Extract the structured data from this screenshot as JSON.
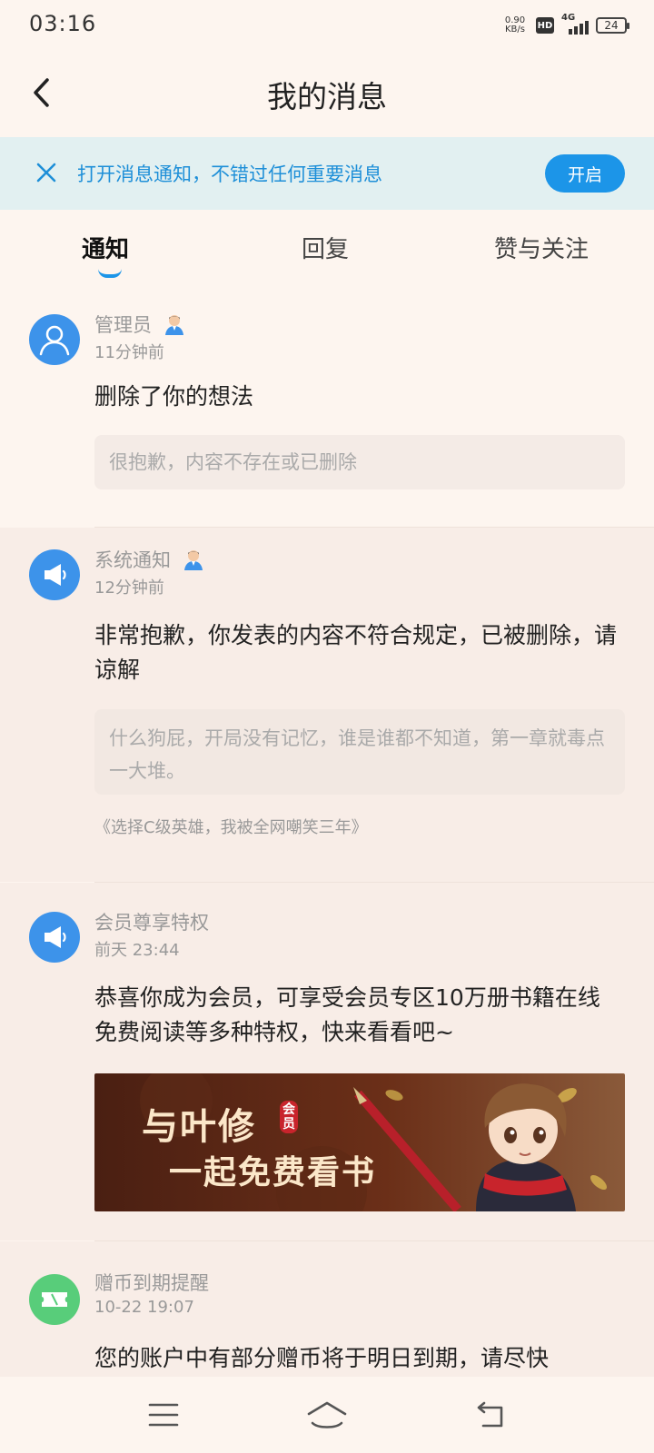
{
  "status_bar": {
    "time": "03:16",
    "net_speed_value": "0.90",
    "net_speed_unit": "KB/s",
    "hd": "HD",
    "network": "4G",
    "battery": "24"
  },
  "header": {
    "title": "我的消息"
  },
  "banner": {
    "text": "打开消息通知，不错过任何重要消息",
    "button": "开启"
  },
  "tabs": [
    {
      "label": "通知",
      "active": true
    },
    {
      "label": "回复",
      "active": false
    },
    {
      "label": "赞与关注",
      "active": false
    }
  ],
  "messages": [
    {
      "sender": "管理员",
      "time": "11分钟前",
      "content": "删除了你的想法",
      "quote": "很抱歉，内容不存在或已删除"
    },
    {
      "sender": "系统通知",
      "time": "12分钟前",
      "content": "非常抱歉，你发表的内容不符合规定，已被删除，请谅解",
      "quote": "什么狗屁，开局没有记忆，谁是谁都不知道，第一章就毒点一大堆。",
      "source": "《选择C级英雄，我被全网嘲笑三年》"
    },
    {
      "sender": "会员尊享特权",
      "time": "前天 23:44",
      "content": "恭喜你成为会员，可享受会员专区10万册书籍在线免费阅读等多种特权，快来看看吧~",
      "banner_line1": "与叶修",
      "banner_badge": "会员",
      "banner_line2": "一起免费看书"
    },
    {
      "sender": "赠币到期提醒",
      "time": "10-22 19:07",
      "content": "您的账户中有部分赠币将于明日到期，请尽快"
    }
  ],
  "colors": {
    "accent": "#1c95e8",
    "avatar_blue": "#3d93ea",
    "avatar_green": "#58cd7a",
    "background": "#fdf5ef"
  }
}
